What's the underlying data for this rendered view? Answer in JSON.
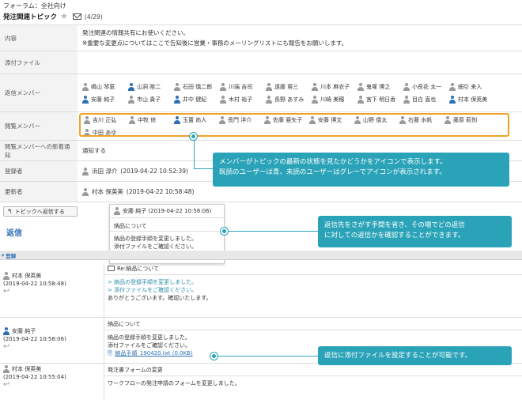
{
  "breadcrumb": "フォーラム：全社向け",
  "topic": {
    "title": "発注関連トピック",
    "count": "(4/29)"
  },
  "labels": {
    "desc": "内容",
    "attach": "添付ファイル",
    "reply_members": "返信メンバー",
    "confirmed_members": "閲覧メンバー",
    "notify": "閲覧メンバーへの新着通知",
    "creator": "登録者",
    "updater": "更新者"
  },
  "description": [
    "発注関連の情報共有にお使いください。",
    "※重要な変更点についてはここで告知後に営業・事務のメーリングリストにも報告をお願いします。"
  ],
  "reply_members": [
    {
      "name": "嶋山 琴恵",
      "read": false
    },
    {
      "name": "山洞 陸二",
      "read": true
    },
    {
      "name": "石田 慎二郎",
      "read": false
    },
    {
      "name": "川端 吉司",
      "read": false
    },
    {
      "name": "遠藤 蓉三",
      "read": false
    },
    {
      "name": "川本 麻衣子",
      "read": false
    },
    {
      "name": "鬼塚 博之",
      "read": false
    },
    {
      "name": "小長花 太一",
      "read": false
    },
    {
      "name": "細引 来人",
      "read": false
    },
    {
      "name": "安藤 純子",
      "read": true
    },
    {
      "name": "市山 貴子",
      "read": false
    },
    {
      "name": "井中 健紀",
      "read": true
    },
    {
      "name": "木村 裕子",
      "read": false
    },
    {
      "name": "長野 あすみ",
      "read": false
    },
    {
      "name": "川崎 美穂",
      "read": false
    },
    {
      "name": "宮下 明日香",
      "read": false
    },
    {
      "name": "目白 直也",
      "read": false
    },
    {
      "name": "村本 保英美",
      "read": true
    }
  ],
  "confirmed_members": [
    {
      "name": "吉川 正弘",
      "read": false
    },
    {
      "name": "中牧 修",
      "read": false
    },
    {
      "name": "玉置 尚人",
      "read": true
    },
    {
      "name": "長門 洋介",
      "read": false
    },
    {
      "name": "佐藤 亜矢子",
      "read": false
    },
    {
      "name": "安藤 博文",
      "read": false
    },
    {
      "name": "山野 倭太",
      "read": false
    },
    {
      "name": "右藤 水帆",
      "read": false
    },
    {
      "name": "藤原 萩別",
      "read": false
    },
    {
      "name": "中田 あゆ",
      "read": false
    }
  ],
  "notify_value": "通知する",
  "creator": {
    "name": "浜田 淳介",
    "date": "(2019-04-22 10:52:39)"
  },
  "updater": {
    "name": "村本 保英美",
    "date": "(2019-04-22 10:58:48)"
  },
  "back_button": "トピックへ返信する",
  "reply_title": "返信",
  "section_label": "登録",
  "callouts": {
    "members": [
      "メンバーがトピックの最新の状態を見たかどうかをアイコンで表示します。",
      "既読のユーザーは青、未読のユーザーはグレーでアイコンが表示されます。"
    ],
    "reply": [
      "返信先をさがす手間を省き、その場でどの返信",
      "に対しての返信かを確認することができます。"
    ],
    "attach": "返信に添付ファイルを設定することが可能です。"
  },
  "popup": {
    "name": "安藤 純子 (2019-04-22 10:58:06)",
    "subject": "納品について",
    "lines": [
      "納品の登録手順を変更しました。",
      "添付ファイルをご確認ください。"
    ]
  },
  "messages": [
    {
      "name": "村本 保英美",
      "date": "(2019-04-22 10:58:48)",
      "subject": "Re:納品について",
      "quote": [
        "> 納品の登録手順を変更しました。",
        "> 添付ファイルをご確認ください。"
      ],
      "lines": [
        "ありがとうございます。確認いたします。"
      ]
    },
    {
      "name": "安藤 純子",
      "date": "(2019-04-22 10:58:06)",
      "subject": "納品について",
      "lines": [
        "納品の登録手順を変更しました。",
        "添付ファイルをご確認ください。"
      ],
      "attachment": "納品手順_190420.txt (0.0KB)"
    },
    {
      "name": "村本 保英美",
      "date": "(2019-04-22 10:55:04)",
      "subject": "発注書フォームの変更",
      "lines": [
        "ワークフローの発注申請のフォームを変更しました。"
      ]
    }
  ],
  "colors": {
    "callout": "#2aa3b8",
    "highlight": "#f0a028",
    "read": "#2d6fb5",
    "unread": "#9a9a9a"
  }
}
